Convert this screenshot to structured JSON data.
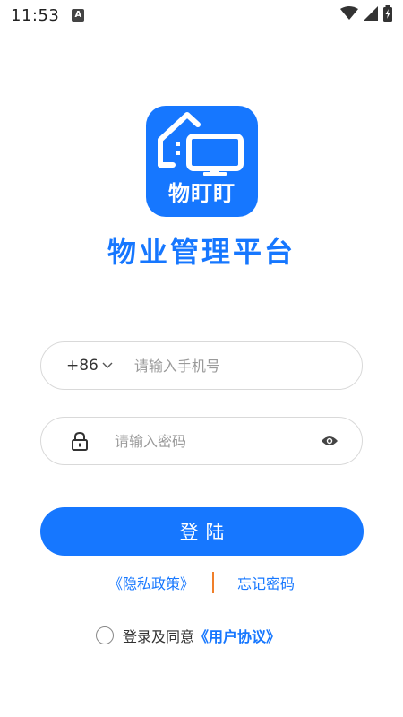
{
  "status_bar": {
    "time": "11:53",
    "notification_icon": "a-badge-icon",
    "icons": [
      "wifi-icon",
      "signal-icon",
      "battery-charging-icon"
    ]
  },
  "logo": {
    "text": "物盯盯",
    "icon": "house-monitor-icon",
    "background_color": "#1677ff"
  },
  "app_title": "物业管理平台",
  "phone": {
    "country_code": "+86",
    "placeholder": "请输入手机号",
    "value": ""
  },
  "password": {
    "placeholder": "请输入密码",
    "value": ""
  },
  "login_label": "登陆",
  "links": {
    "privacy_policy": "《隐私政策》",
    "forgot_password": "忘记密码"
  },
  "agreement": {
    "text": "登录及同意",
    "link": "《用户协议》",
    "checked": false
  },
  "colors": {
    "accent": "#1677ff",
    "divider": "#f07f2a"
  }
}
